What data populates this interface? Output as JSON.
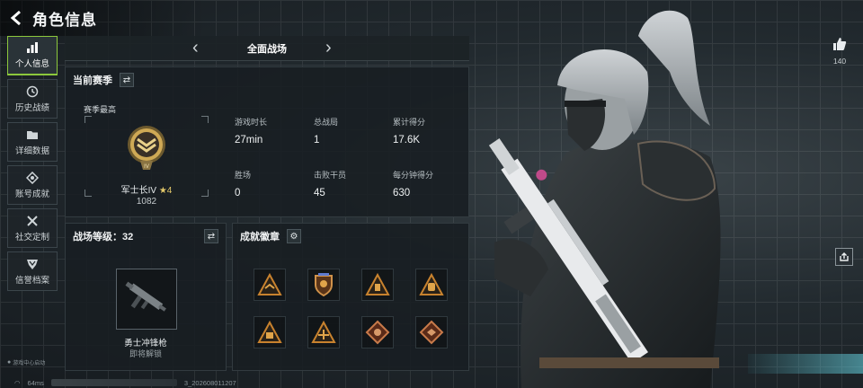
{
  "header": {
    "title": "角色信息"
  },
  "sidebar": {
    "items": [
      {
        "label": "个人信息",
        "icon": "bar-chart-icon",
        "active": true
      },
      {
        "label": "历史战绩",
        "icon": "clock-icon",
        "active": false
      },
      {
        "label": "详细数据",
        "icon": "folder-icon",
        "active": false
      },
      {
        "label": "账号成就",
        "icon": "medal-icon",
        "active": false
      },
      {
        "label": "社交定制",
        "icon": "tools-icon",
        "active": false
      },
      {
        "label": "信誉档案",
        "icon": "shield-icon",
        "active": false
      }
    ],
    "game_center": "游戏中心启动"
  },
  "status": {
    "ping": "64ms",
    "build": "3_202608011207"
  },
  "tabbar": {
    "title": "全面战场"
  },
  "season": {
    "title": "当前赛季",
    "best_label": "赛季最高",
    "rank_name": "军士长IV",
    "rank_stars": "★4",
    "rank_points": "1082",
    "stats": [
      {
        "label": "游戏时长",
        "value": "27min"
      },
      {
        "label": "总战局",
        "value": "1"
      },
      {
        "label": "累计得分",
        "value": "17.6K"
      },
      {
        "label": "胜场",
        "value": "0"
      },
      {
        "label": "击败干员",
        "value": "45"
      },
      {
        "label": "每分钟得分",
        "value": "630"
      }
    ]
  },
  "level": {
    "title": "战场等级：32",
    "weapon_name": "勇士冲锋枪",
    "weapon_status": "即将解锁"
  },
  "achievements": {
    "title": "成就徽章",
    "badges": [
      "badge-1",
      "badge-2",
      "badge-3",
      "badge-4",
      "badge-5",
      "badge-6",
      "badge-7",
      "badge-8"
    ]
  },
  "likes": {
    "count": "140"
  },
  "colors": {
    "accent": "#8cc83c",
    "gold": "#e4c96a",
    "badge_orange": "#c8822e"
  }
}
